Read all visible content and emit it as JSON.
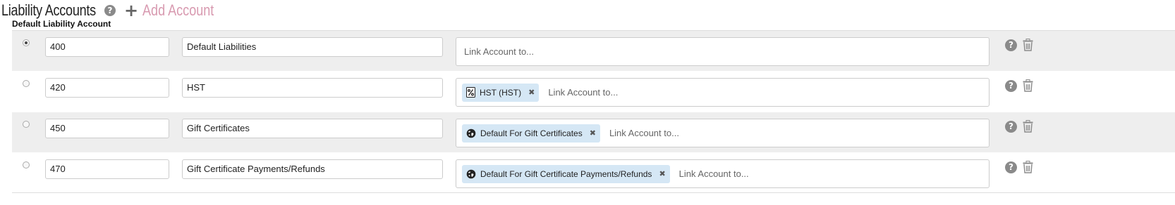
{
  "header": {
    "title": "Liability Accounts",
    "help_icon": "question-circle-icon",
    "add_icon": "plus-icon",
    "add_label": "Add Account",
    "add_color": "#d89ab0"
  },
  "default_label": "Default Liability Account",
  "rows": [
    {
      "selected": true,
      "number": "400",
      "name": "Default Liabilities",
      "tags": [],
      "link_placeholder": "Link Account to..."
    },
    {
      "selected": false,
      "number": "420",
      "name": "HST",
      "tags": [
        {
          "icon": "percent-icon",
          "label": "HST (HST)"
        }
      ],
      "link_placeholder": "Link Account to..."
    },
    {
      "selected": false,
      "number": "450",
      "name": "Gift Certificates",
      "tags": [
        {
          "icon": "globe-icon",
          "label": "Default For Gift Certificates"
        }
      ],
      "link_placeholder": "Link Account to..."
    },
    {
      "selected": false,
      "number": "470",
      "name": "Gift Certificate Payments/Refunds",
      "tags": [
        {
          "icon": "globe-icon",
          "label": "Default For Gift Certificate Payments/Refunds"
        }
      ],
      "link_placeholder": "Link Account to..."
    }
  ],
  "row_actions": {
    "help_icon": "question-circle-icon",
    "delete_icon": "trash-icon"
  },
  "colors": {
    "row_shade": "#eeeeee",
    "tag_bg": "#d5e7f5",
    "icon_gray": "#8a8a8a"
  }
}
